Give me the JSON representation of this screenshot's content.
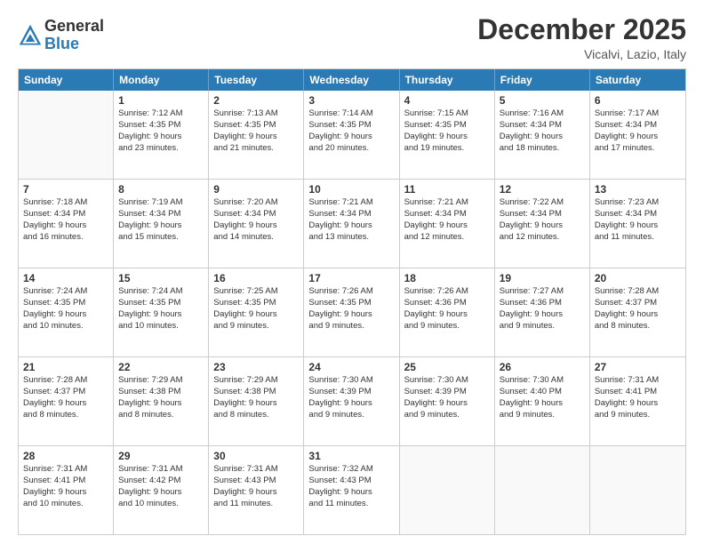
{
  "logo": {
    "general": "General",
    "blue": "Blue"
  },
  "title": "December 2025",
  "location": "Vicalvi, Lazio, Italy",
  "header": {
    "days": [
      "Sunday",
      "Monday",
      "Tuesday",
      "Wednesday",
      "Thursday",
      "Friday",
      "Saturday"
    ]
  },
  "weeks": [
    [
      {
        "day": "",
        "sunrise": "",
        "sunset": "",
        "daylight": ""
      },
      {
        "day": "1",
        "sunrise": "Sunrise: 7:12 AM",
        "sunset": "Sunset: 4:35 PM",
        "daylight": "Daylight: 9 hours and 23 minutes."
      },
      {
        "day": "2",
        "sunrise": "Sunrise: 7:13 AM",
        "sunset": "Sunset: 4:35 PM",
        "daylight": "Daylight: 9 hours and 21 minutes."
      },
      {
        "day": "3",
        "sunrise": "Sunrise: 7:14 AM",
        "sunset": "Sunset: 4:35 PM",
        "daylight": "Daylight: 9 hours and 20 minutes."
      },
      {
        "day": "4",
        "sunrise": "Sunrise: 7:15 AM",
        "sunset": "Sunset: 4:35 PM",
        "daylight": "Daylight: 9 hours and 19 minutes."
      },
      {
        "day": "5",
        "sunrise": "Sunrise: 7:16 AM",
        "sunset": "Sunset: 4:34 PM",
        "daylight": "Daylight: 9 hours and 18 minutes."
      },
      {
        "day": "6",
        "sunrise": "Sunrise: 7:17 AM",
        "sunset": "Sunset: 4:34 PM",
        "daylight": "Daylight: 9 hours and 17 minutes."
      }
    ],
    [
      {
        "day": "7",
        "sunrise": "Sunrise: 7:18 AM",
        "sunset": "Sunset: 4:34 PM",
        "daylight": "Daylight: 9 hours and 16 minutes."
      },
      {
        "day": "8",
        "sunrise": "Sunrise: 7:19 AM",
        "sunset": "Sunset: 4:34 PM",
        "daylight": "Daylight: 9 hours and 15 minutes."
      },
      {
        "day": "9",
        "sunrise": "Sunrise: 7:20 AM",
        "sunset": "Sunset: 4:34 PM",
        "daylight": "Daylight: 9 hours and 14 minutes."
      },
      {
        "day": "10",
        "sunrise": "Sunrise: 7:21 AM",
        "sunset": "Sunset: 4:34 PM",
        "daylight": "Daylight: 9 hours and 13 minutes."
      },
      {
        "day": "11",
        "sunrise": "Sunrise: 7:21 AM",
        "sunset": "Sunset: 4:34 PM",
        "daylight": "Daylight: 9 hours and 12 minutes."
      },
      {
        "day": "12",
        "sunrise": "Sunrise: 7:22 AM",
        "sunset": "Sunset: 4:34 PM",
        "daylight": "Daylight: 9 hours and 12 minutes."
      },
      {
        "day": "13",
        "sunrise": "Sunrise: 7:23 AM",
        "sunset": "Sunset: 4:34 PM",
        "daylight": "Daylight: 9 hours and 11 minutes."
      }
    ],
    [
      {
        "day": "14",
        "sunrise": "Sunrise: 7:24 AM",
        "sunset": "Sunset: 4:35 PM",
        "daylight": "Daylight: 9 hours and 10 minutes."
      },
      {
        "day": "15",
        "sunrise": "Sunrise: 7:24 AM",
        "sunset": "Sunset: 4:35 PM",
        "daylight": "Daylight: 9 hours and 10 minutes."
      },
      {
        "day": "16",
        "sunrise": "Sunrise: 7:25 AM",
        "sunset": "Sunset: 4:35 PM",
        "daylight": "Daylight: 9 hours and 9 minutes."
      },
      {
        "day": "17",
        "sunrise": "Sunrise: 7:26 AM",
        "sunset": "Sunset: 4:35 PM",
        "daylight": "Daylight: 9 hours and 9 minutes."
      },
      {
        "day": "18",
        "sunrise": "Sunrise: 7:26 AM",
        "sunset": "Sunset: 4:36 PM",
        "daylight": "Daylight: 9 hours and 9 minutes."
      },
      {
        "day": "19",
        "sunrise": "Sunrise: 7:27 AM",
        "sunset": "Sunset: 4:36 PM",
        "daylight": "Daylight: 9 hours and 9 minutes."
      },
      {
        "day": "20",
        "sunrise": "Sunrise: 7:28 AM",
        "sunset": "Sunset: 4:37 PM",
        "daylight": "Daylight: 9 hours and 8 minutes."
      }
    ],
    [
      {
        "day": "21",
        "sunrise": "Sunrise: 7:28 AM",
        "sunset": "Sunset: 4:37 PM",
        "daylight": "Daylight: 9 hours and 8 minutes."
      },
      {
        "day": "22",
        "sunrise": "Sunrise: 7:29 AM",
        "sunset": "Sunset: 4:38 PM",
        "daylight": "Daylight: 9 hours and 8 minutes."
      },
      {
        "day": "23",
        "sunrise": "Sunrise: 7:29 AM",
        "sunset": "Sunset: 4:38 PM",
        "daylight": "Daylight: 9 hours and 8 minutes."
      },
      {
        "day": "24",
        "sunrise": "Sunrise: 7:30 AM",
        "sunset": "Sunset: 4:39 PM",
        "daylight": "Daylight: 9 hours and 9 minutes."
      },
      {
        "day": "25",
        "sunrise": "Sunrise: 7:30 AM",
        "sunset": "Sunset: 4:39 PM",
        "daylight": "Daylight: 9 hours and 9 minutes."
      },
      {
        "day": "26",
        "sunrise": "Sunrise: 7:30 AM",
        "sunset": "Sunset: 4:40 PM",
        "daylight": "Daylight: 9 hours and 9 minutes."
      },
      {
        "day": "27",
        "sunrise": "Sunrise: 7:31 AM",
        "sunset": "Sunset: 4:41 PM",
        "daylight": "Daylight: 9 hours and 9 minutes."
      }
    ],
    [
      {
        "day": "28",
        "sunrise": "Sunrise: 7:31 AM",
        "sunset": "Sunset: 4:41 PM",
        "daylight": "Daylight: 9 hours and 10 minutes."
      },
      {
        "day": "29",
        "sunrise": "Sunrise: 7:31 AM",
        "sunset": "Sunset: 4:42 PM",
        "daylight": "Daylight: 9 hours and 10 minutes."
      },
      {
        "day": "30",
        "sunrise": "Sunrise: 7:31 AM",
        "sunset": "Sunset: 4:43 PM",
        "daylight": "Daylight: 9 hours and 11 minutes."
      },
      {
        "day": "31",
        "sunrise": "Sunrise: 7:32 AM",
        "sunset": "Sunset: 4:43 PM",
        "daylight": "Daylight: 9 hours and 11 minutes."
      },
      {
        "day": "",
        "sunrise": "",
        "sunset": "",
        "daylight": ""
      },
      {
        "day": "",
        "sunrise": "",
        "sunset": "",
        "daylight": ""
      },
      {
        "day": "",
        "sunrise": "",
        "sunset": "",
        "daylight": ""
      }
    ]
  ]
}
